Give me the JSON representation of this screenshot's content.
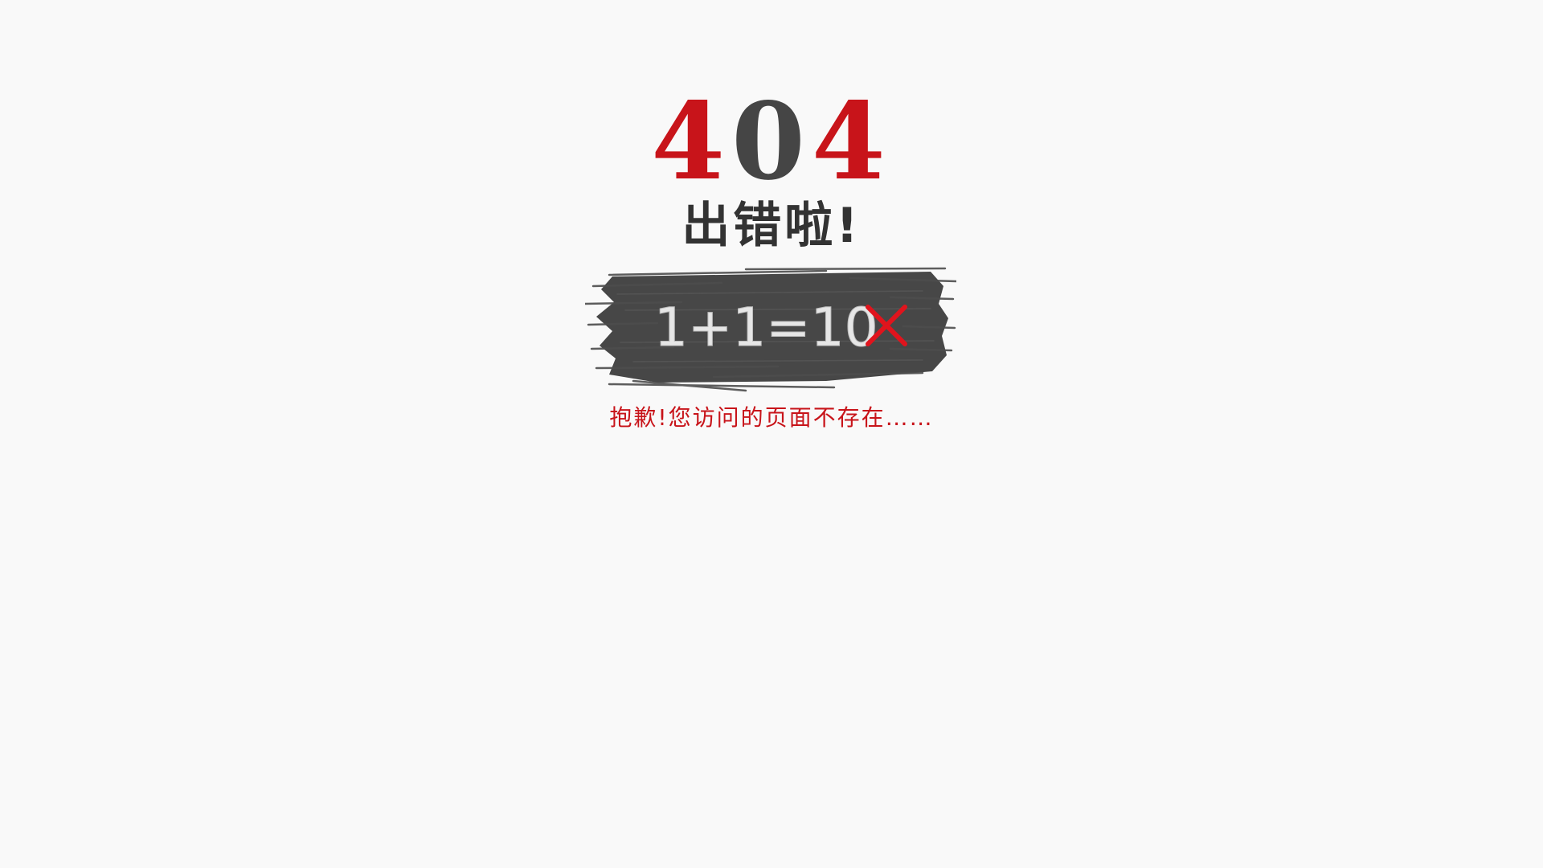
{
  "error": {
    "code_digits": [
      "4",
      "0",
      "4"
    ],
    "title": "出错啦!"
  },
  "chalkboard": {
    "equation": "1+1=10",
    "mark_icon": "x-mark-icon"
  },
  "message": "抱歉!您访问的页面不存在……",
  "colors": {
    "background": "#f9f9f9",
    "accent_red": "#c8141a",
    "dark_gray": "#454545",
    "brush": "#474747"
  }
}
